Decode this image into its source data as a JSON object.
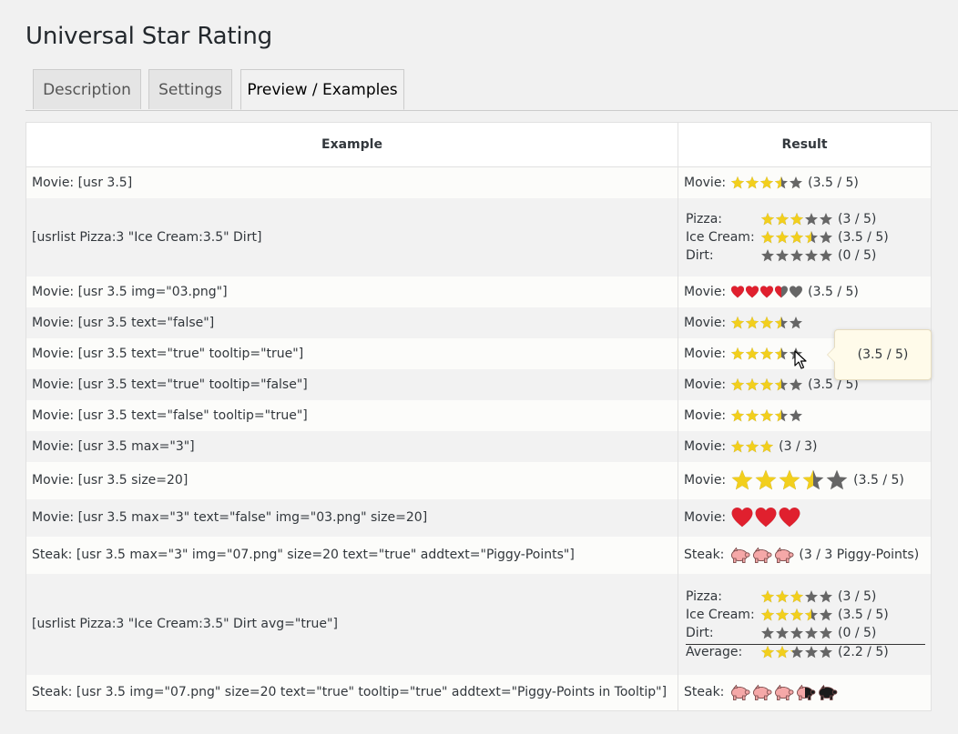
{
  "page": {
    "title": "Universal Star Rating"
  },
  "tabs": [
    {
      "label": "Description",
      "active": false
    },
    {
      "label": "Settings",
      "active": false
    },
    {
      "label": "Preview / Examples",
      "active": true
    }
  ],
  "table": {
    "headers": [
      "Example",
      "Result"
    ],
    "rows": [
      {
        "example": "Movie: [usr 3.5]",
        "label": "Movie:",
        "icon": "star",
        "value": 3.5,
        "max": 5,
        "size": 16,
        "text": "(3.5 / 5)"
      },
      {
        "example": "[usrlist Pizza:3 \"Ice Cream:3.5\" Dirt]",
        "list": [
          {
            "label": "Pizza:",
            "value": 3,
            "text": "(3 / 5)"
          },
          {
            "label": "Ice Cream:",
            "value": 3.5,
            "text": "(3.5 / 5)"
          },
          {
            "label": "Dirt:",
            "value": 0,
            "text": "(0 / 5)"
          }
        ]
      },
      {
        "example": "Movie: [usr 3.5 img=\"03.png\"]",
        "label": "Movie:",
        "icon": "heart",
        "value": 3.5,
        "max": 5,
        "size": 16,
        "text": "(3.5 / 5)"
      },
      {
        "example": "Movie: [usr 3.5 text=\"false\"]",
        "label": "Movie:",
        "icon": "star",
        "value": 3.5,
        "max": 5,
        "size": 16,
        "text": ""
      },
      {
        "example": "Movie: [usr 3.5 text=\"true\" tooltip=\"true\"]",
        "label": "Movie:",
        "icon": "star",
        "value": 3.5,
        "max": 5,
        "size": 16,
        "text": ""
      },
      {
        "example": "Movie: [usr 3.5 text=\"true\" tooltip=\"false\"]",
        "label": "Movie:",
        "icon": "star",
        "value": 3.5,
        "max": 5,
        "size": 16,
        "text": "(3.5 / 5)"
      },
      {
        "example": "Movie: [usr 3.5 text=\"false\" tooltip=\"true\"]",
        "label": "Movie:",
        "icon": "star",
        "value": 3.5,
        "max": 5,
        "size": 16,
        "text": ""
      },
      {
        "example": "Movie: [usr 3.5 max=\"3\"]",
        "label": "Movie:",
        "icon": "star",
        "value": 3,
        "max": 3,
        "size": 16,
        "text": "(3 / 3)"
      },
      {
        "example": "Movie: [usr 3.5 size=20]",
        "label": "Movie:",
        "icon": "star",
        "value": 3.5,
        "max": 5,
        "size": 26,
        "text": "(3.5 / 5)"
      },
      {
        "example": "Movie: [usr 3.5 max=\"3\" text=\"false\" img=\"03.png\" size=20]",
        "label": "Movie:",
        "icon": "heart",
        "value": 3,
        "max": 3,
        "size": 26,
        "text": ""
      },
      {
        "example": "Steak: [usr 3.5 max=\"3\" img=\"07.png\" size=20 text=\"true\" addtext=\"Piggy-Points\"]",
        "label": "Steak:",
        "icon": "pig",
        "value": 3,
        "max": 3,
        "size": 24,
        "text": "(3 / 3 Piggy-Points)"
      },
      {
        "example": "[usrlist Pizza:3 \"Ice Cream:3.5\" Dirt avg=\"true\"]",
        "list": [
          {
            "label": "Pizza:",
            "value": 3,
            "text": "(3 / 5)"
          },
          {
            "label": "Ice Cream:",
            "value": 3.5,
            "text": "(3.5 / 5)"
          },
          {
            "label": "Dirt:",
            "value": 0,
            "text": "(0 / 5)"
          },
          {
            "label": "Average:",
            "value": 2.2,
            "text": "(2.2 / 5)"
          }
        ]
      },
      {
        "example": "Steak: [usr 3.5 img=\"07.png\" size=20 text=\"true\" tooltip=\"true\" addtext=\"Piggy-Points in Tooltip\"]",
        "label": "Steak:",
        "icon": "pig",
        "value": 3.5,
        "max": 5,
        "size": 24,
        "text": ""
      }
    ]
  },
  "tooltip": {
    "text": "(3.5 / 5)"
  },
  "colors": {
    "star_filled": "#f2cf1d",
    "star_empty": "#666666",
    "heart_filled": "#e0202e",
    "pig_filled": "#f5a8a8",
    "pig_empty": "#1a1a1a"
  }
}
